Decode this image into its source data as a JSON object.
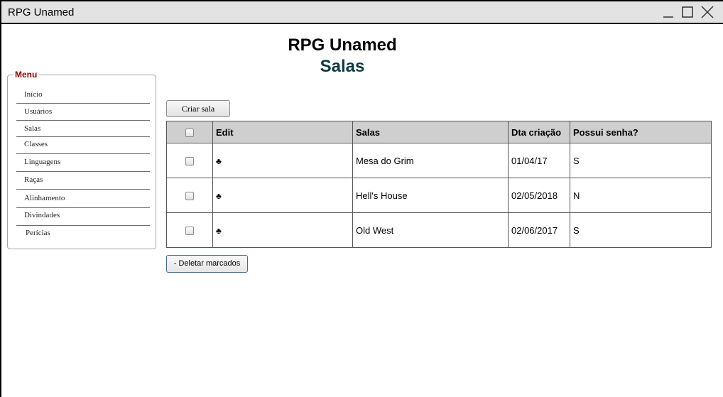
{
  "window": {
    "title": "RPG Unamed"
  },
  "page": {
    "title": "RPG Unamed",
    "subtitle": "Salas",
    "subtitle_color": "#0e3a46"
  },
  "menu": {
    "legend": "Menu",
    "legend_color": "#8b0000",
    "items": [
      {
        "label": "Início"
      },
      {
        "label": "Usuários"
      },
      {
        "label": "Salas"
      },
      {
        "label": "Classes"
      },
      {
        "label": "Linguagens"
      },
      {
        "label": "Raças"
      },
      {
        "label": "Alinhamento"
      },
      {
        "label": "Divindades"
      },
      {
        "label": "Perícias"
      }
    ]
  },
  "toolbar": {
    "create_label": "Criar sala",
    "delete_label": "- Deletar marcados"
  },
  "table": {
    "headers": [
      "Edit",
      "Salas",
      "Dta criação",
      "Possui senha?"
    ],
    "edit_icon": "♣",
    "rows": [
      {
        "sala": "Mesa do Grim",
        "data": "01/04/17",
        "senha": "S"
      },
      {
        "sala": "Hell's House",
        "data": "02/05/2018",
        "senha": "N"
      },
      {
        "sala": "Old West",
        "data": "02/06/2017",
        "senha": "S"
      }
    ]
  }
}
